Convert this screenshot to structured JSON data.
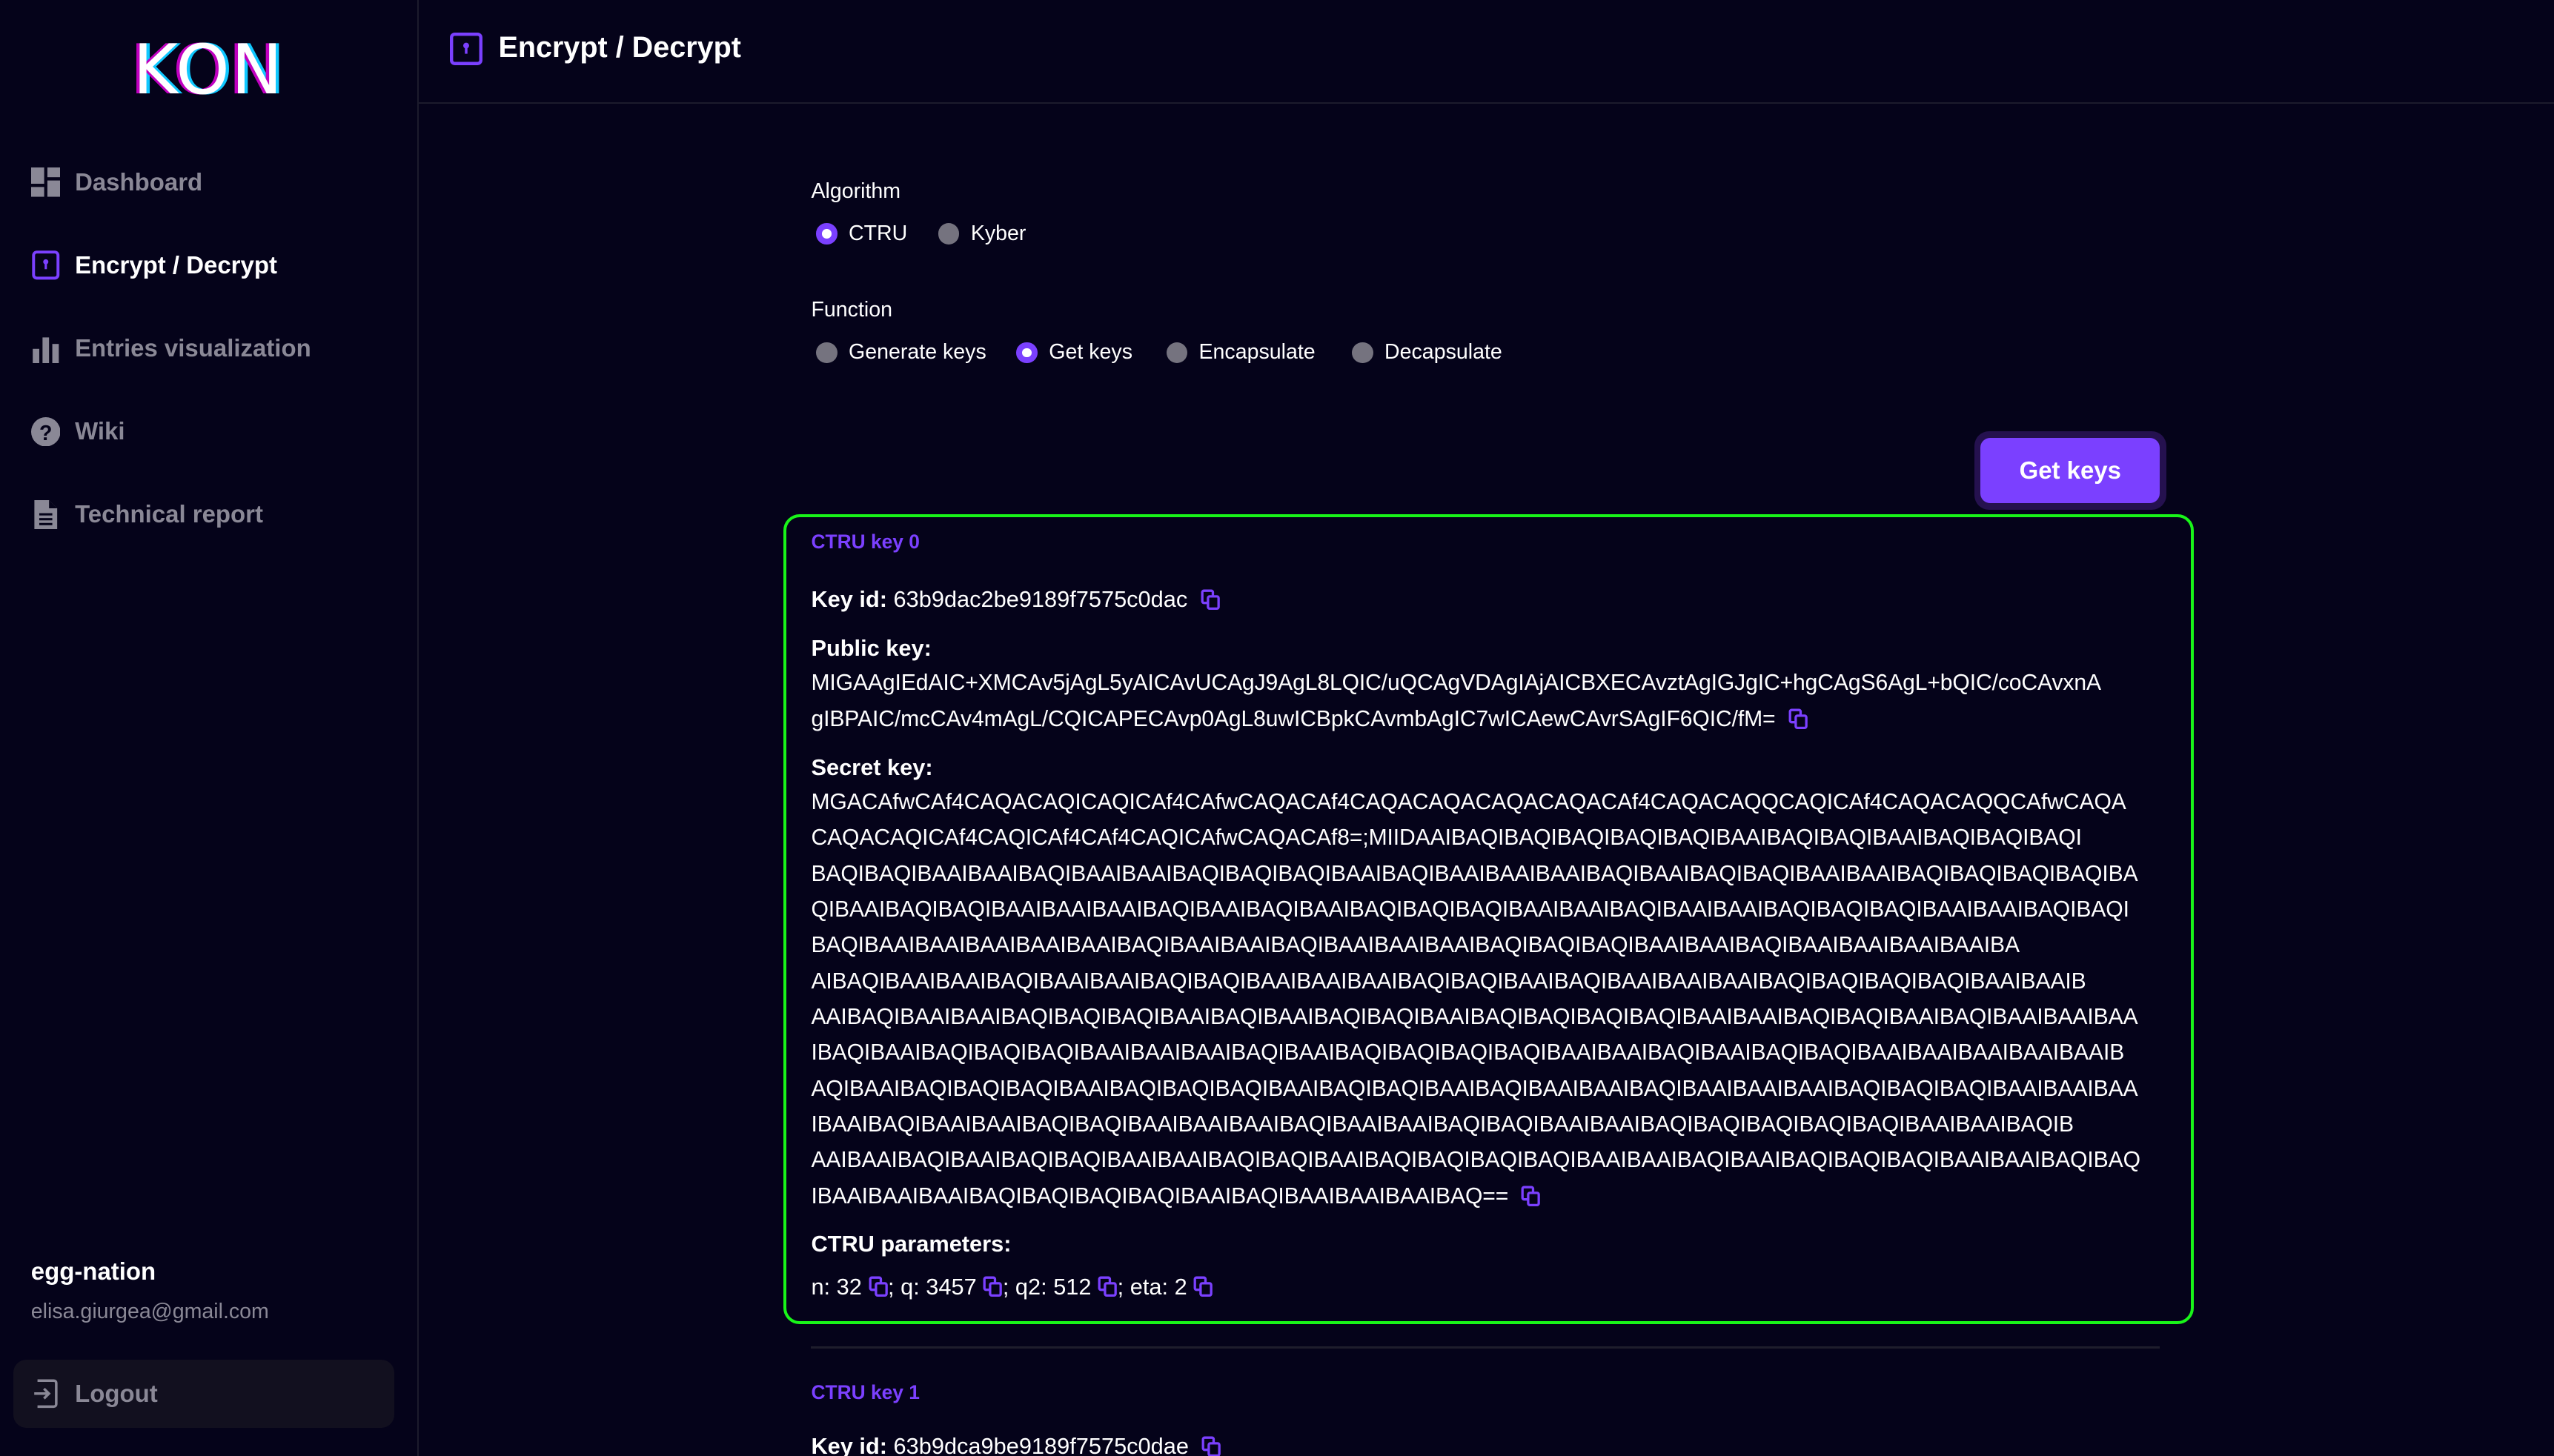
{
  "app": {
    "logo": "KON"
  },
  "sidebar": {
    "items": [
      {
        "label": "Dashboard",
        "icon": "dashboard-icon"
      },
      {
        "label": "Encrypt / Decrypt",
        "icon": "lock-icon",
        "active": true
      },
      {
        "label": "Entries visualization",
        "icon": "bar-chart-icon"
      },
      {
        "label": "Wiki",
        "icon": "help-icon"
      },
      {
        "label": "Technical report",
        "icon": "document-icon"
      }
    ],
    "user": {
      "name": "egg-nation",
      "email": "elisa.giurgea@gmail.com"
    },
    "logout_label": "Logout"
  },
  "header": {
    "title": "Encrypt / Decrypt"
  },
  "form": {
    "algorithm_label": "Algorithm",
    "algorithms": [
      {
        "label": "CTRU",
        "selected": true
      },
      {
        "label": "Kyber",
        "selected": false
      }
    ],
    "function_label": "Function",
    "functions": [
      {
        "label": "Generate keys",
        "selected": false
      },
      {
        "label": "Get keys",
        "selected": true
      },
      {
        "label": "Encapsulate",
        "selected": false
      },
      {
        "label": "Decapsulate",
        "selected": false
      }
    ],
    "submit_label": "Get keys"
  },
  "colors": {
    "accent": "#7b40ff",
    "highlight_border": "#19f519",
    "background": "#05031a"
  },
  "keys": [
    {
      "title": "CTRU key 0",
      "key_id_label": "Key id:",
      "key_id": "63b9dac2be9189f7575c0dac",
      "public_key_label": "Public key:",
      "public_key_lines": [
        "MIGAAgIEdAIC+XMCAv5jAgL5yAICAvUCAgJ9AgL8LQIC/uQCAgVDAgIAjAICBXECAvztAgIGJgIC+hgCAgS6AgL+bQIC/coCAvxnA",
        "gIBPAIC/mcCAv4mAgL/CQICAPECAvp0AgL8uwICBpkCAvmbAgIC7wICAewCAvrSAgIF6QIC/fM="
      ],
      "secret_key_label": "Secret key:",
      "secret_key_lines": [
        "MGACAfwCAf4CAQACAQICAQICAf4CAfwCAQACAf4CAQACAQACAQACAQACAf4CAQACAQQCAQICAf4CAQACAQQCAfwCAQA",
        "CAQACAQICAf4CAQICAf4CAf4CAQICAfwCAQACAf8=;MIIDAAIBAQIBAQIBAQIBAQIBAQIBAAIBAQIBAQIBAAIBAQIBAQIBAQI",
        "BAQIBAQIBAAIBAAIBAQIBAAIBAAIBAQIBAQIBAQIBAAIBAQIBAAIBAAIBAAIBAQIBAAIBAQIBAQIBAAIBAAIBAQIBAQIBAQIBAQIBA",
        "QIBAAIBAQIBAQIBAAIBAAIBAAIBAQIBAAIBAQIBAAIBAQIBAQIBAQIBAAIBAAIBAQIBAAIBAAIBAQIBAQIBAQIBAAIBAAIBAQIBAQI",
        "BAQIBAAIBAAIBAAIBAAIBAAIBAQIBAAIBAAIBAQIBAAIBAAIBAAIBAQIBAQIBAQIBAAIBAAIBAQIBAAIBAAIBAAIBAAIBA",
        "AIBAQIBAAIBAAIBAQIBAAIBAAIBAQIBAQIBAAIBAAIBAAIBAQIBAQIBAAIBAQIBAAIBAAIBAAIBAQIBAQIBAQIBAQIBAAIBAAIB",
        "AAIBAQIBAAIBAAIBAQIBAQIBAQIBAAIBAQIBAAIBAQIBAQIBAAIBAQIBAQIBAQIBAQIBAAIBAAIBAQIBAQIBAAIBAQIBAAIBAAIBAA",
        "IBAQIBAAIBAQIBAQIBAQIBAAIBAAIBAAIBAQIBAAIBAQIBAQIBAQIBAQIBAAIBAAIBAQIBAAIBAQIBAQIBAAIBAAIBAAIBAAIBAAIB",
        "AQIBAAIBAQIBAQIBAQIBAAIBAQIBAQIBAQIBAAIBAQIBAQIBAAIBAQIBAAIBAAIBAQIBAAIBAAIBAAIBAQIBAQIBAQIBAAIBAAIBAA",
        "IBAAIBAQIBAAIBAAIBAQIBAQIBAAIBAAIBAAIBAQIBAAIBAAIBAQIBAQIBAAIBAAIBAQIBAQIBAQIBAQIBAQIBAAIBAAIBAQIB",
        "AAIBAAIBAQIBAAIBAQIBAQIBAAIBAAIBAQIBAQIBAAIBAQIBAQIBAQIBAQIBAAIBAAIBAQIBAAIBAQIBAQIBAQIBAAIBAAIBAQIBAQ",
        "IBAAIBAAIBAAIBAQIBAQIBAQIBAQIBAAIBAQIBAAIBAAIBAAIBAQ=="
      ],
      "params_label": "CTRU parameters:",
      "params": {
        "n": "n: 32",
        "q": "; q: 3457",
        "q2": "; q2: 512",
        "eta": "; eta: 2"
      }
    },
    {
      "title": "CTRU key 1",
      "key_id_label": "Key id:",
      "key_id": "63b9dca9be9189f7575c0dae"
    }
  ]
}
